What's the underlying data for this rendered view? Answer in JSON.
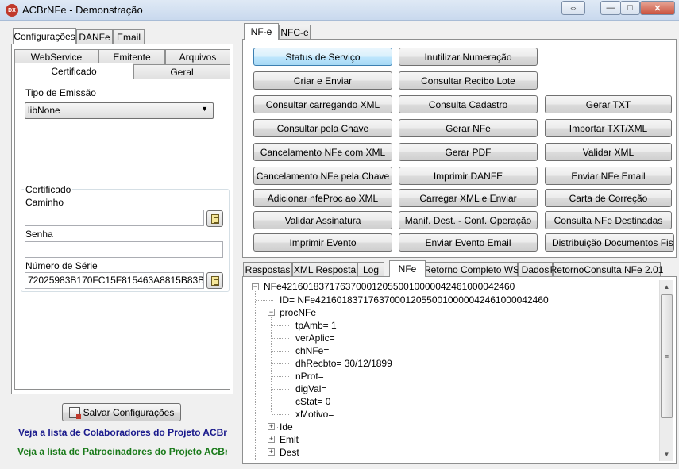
{
  "window": {
    "icon_text": "DX",
    "title": "ACBrNFe - Demonstração",
    "buttons": {
      "restore": "⇔",
      "minimize": "—",
      "maximize": "□",
      "close": "✕"
    }
  },
  "left": {
    "top_tabs": [
      "Configurações",
      "DANFe",
      "Email"
    ],
    "sub_tabs_row1": [
      "WebService",
      "Emitente",
      "Arquivos"
    ],
    "sub_tabs_row2": [
      "Certificado",
      "Geral"
    ],
    "tipo_emissao_label": "Tipo de Emissão",
    "tipo_emissao_value": "libNone",
    "certificado_group": "Certificado",
    "caminho_label": "Caminho",
    "caminho_value": "",
    "senha_label": "Senha",
    "senha_value": "",
    "numero_serie_label": "Número de Série",
    "numero_serie_value": "72025983B170FC15F815463A8815B83B",
    "save_button": "Salvar Configurações",
    "link_colaboradores": "Veja a lista de Colaboradores do Projeto ACBr",
    "link_patrocinadores": "Veja a lista de Patrocinadores do Projeto ACBr",
    "colors": {
      "link_colaboradores": "#1a1a8c",
      "link_patrocinadores": "#1a7a1a"
    }
  },
  "right": {
    "top_tabs": [
      "NF-e",
      "NFC-e"
    ],
    "buttons": {
      "status_servico": "Status de Serviço",
      "inutilizar": "Inutilizar Numeração",
      "criar_enviar": "Criar e Enviar",
      "consultar_recibo": "Consultar Recibo Lote",
      "consultar_xml": "Consultar carregando XML",
      "consulta_cadastro": "Consulta Cadastro",
      "gerar_txt": "Gerar TXT",
      "consultar_chave": "Consultar pela Chave",
      "gerar_nfe": "Gerar NFe",
      "importar_txt": "Importar TXT/XML",
      "cancel_xml": "Cancelamento NFe com XML",
      "gerar_pdf": "Gerar PDF",
      "validar_xml": "Validar XML",
      "cancel_chave": "Cancelamento NFe pela Chave",
      "imprimir_danfe": "Imprimir DANFE",
      "enviar_email": "Enviar NFe Email",
      "adicionar_nfeproc": "Adicionar nfeProc ao XML",
      "carregar_xml_enviar": "Carregar XML e Enviar",
      "carta_correcao": "Carta de Correção",
      "validar_assinatura": "Validar Assinatura",
      "manif_dest": "Manif. Dest. - Conf. Operação",
      "consulta_destinadas": "Consulta NFe Destinadas",
      "imprimir_evento": "Imprimir Evento",
      "enviar_evento_email": "Enviar Evento Email",
      "distribuicao": "Distribuição Documentos Fiscais"
    },
    "bottom_tabs": [
      "Respostas",
      "XML Resposta",
      "Log",
      "NFe",
      "Retorno Completo WS",
      "Dados",
      "RetornoConsulta NFe 2.01"
    ],
    "tree": {
      "root": "NFe42160183717637000120550010000042461000042460",
      "id": "ID= NFe42160183717637000120550010000042461000042460",
      "procNFe": "procNFe",
      "fields": [
        "tpAmb= 1",
        "verAplic=",
        "chNFe=",
        "dhRecbto= 30/12/1899",
        "nProt=",
        "digVal=",
        "cStat= 0",
        "xMotivo="
      ],
      "nodes": [
        "Ide",
        "Emit",
        "Dest"
      ]
    }
  }
}
